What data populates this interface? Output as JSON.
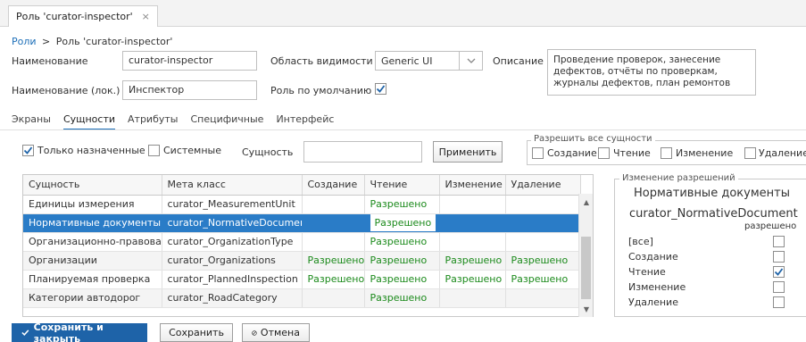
{
  "tab": {
    "title": "Роль 'curator-inspector'",
    "close": "×"
  },
  "breadcrumb": {
    "root": "Роли",
    "separator": ">",
    "current": "Роль 'curator-inspector'"
  },
  "form": {
    "name_label": "Наименование",
    "name_value": "curator-inspector",
    "scope_label": "Область видимости",
    "scope_value": "Generic UI",
    "description_label": "Описание",
    "description_value": "Проведение проверок, занесение дефектов, отчёты по проверкам, журналы дефектов, план ремонтов",
    "loc_name_label": "Наименование (лок.)",
    "loc_name_value": "Инспектор",
    "default_role_label": "Роль по умолчанию",
    "default_role_checked": true
  },
  "subtabs": [
    "Экраны",
    "Сущности",
    "Атрибуты",
    "Специфичные",
    "Интерфейс"
  ],
  "active_subtab": "Сущности",
  "filters": {
    "assigned_only_label": "Только назначенные",
    "assigned_only_checked": true,
    "system_label": "Системные",
    "system_checked": false,
    "entity_label": "Сущность",
    "entity_value": "",
    "apply_button": "Применить"
  },
  "allow_all": {
    "legend": "Разрешить все сущности",
    "options": [
      "Создание",
      "Чтение",
      "Изменение",
      "Удаление"
    ]
  },
  "grid": {
    "columns": [
      "Сущность",
      "Мета класс",
      "Создание",
      "Чтение",
      "Изменение",
      "Удаление"
    ],
    "rows": [
      {
        "entity": "Единицы измерения",
        "meta": "curator_MeasurementUnit",
        "create": "",
        "read": "Разрешено",
        "update": "",
        "delete": ""
      },
      {
        "entity": "Нормативные документы",
        "meta": "curator_NormativeDocument",
        "create": "",
        "read": "Разрешено",
        "update": "",
        "delete": "",
        "selected": true
      },
      {
        "entity": "Организационно-правовая",
        "meta": "curator_OrganizationType",
        "create": "",
        "read": "Разрешено",
        "update": "",
        "delete": ""
      },
      {
        "entity": "Организации",
        "meta": "curator_Organizations",
        "create": "Разрешено",
        "read": "Разрешено",
        "update": "Разрешено",
        "delete": "Разрешено"
      },
      {
        "entity": "Планируемая проверка",
        "meta": "curator_PlannedInspection",
        "create": "Разрешено",
        "read": "Разрешено",
        "update": "Разрешено",
        "delete": "Разрешено"
      },
      {
        "entity": "Категории автодорог",
        "meta": "curator_RoadCategory",
        "create": "",
        "read": "Разрешено",
        "update": "",
        "delete": ""
      }
    ]
  },
  "permissions_panel": {
    "legend": "Изменение разрешений",
    "entity_caption": "Нормативные документы",
    "meta_class": "curator_NormativeDocument",
    "allowed_header": "разрешено",
    "rows": [
      {
        "label": "[все]",
        "checked": false
      },
      {
        "label": "Создание",
        "checked": false
      },
      {
        "label": "Чтение",
        "checked": true
      },
      {
        "label": "Изменение",
        "checked": false
      },
      {
        "label": "Удаление",
        "checked": false
      }
    ]
  },
  "footer": {
    "save_close": "Сохранить и закрыть",
    "save": "Сохранить",
    "cancel": "Отмена"
  },
  "colors": {
    "accent": "#1e63a8",
    "selected_row": "#2a7cc7",
    "allowed_text": "#1b8a1b"
  }
}
